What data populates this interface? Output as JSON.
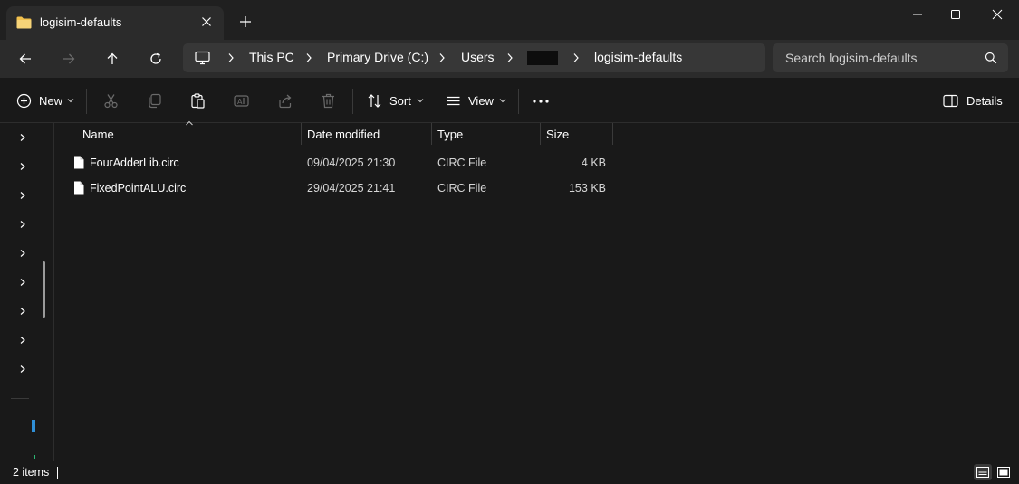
{
  "tab": {
    "title": "logisim-defaults"
  },
  "breadcrumb": {
    "items": [
      "This PC",
      "Primary Drive (C:)",
      "Users",
      "logisim-defaults"
    ]
  },
  "search": {
    "placeholder": "Search logisim-defaults"
  },
  "toolbar": {
    "new_label": "New",
    "sort_label": "Sort",
    "view_label": "View",
    "details_label": "Details"
  },
  "columns": {
    "name": "Name",
    "date": "Date modified",
    "type": "Type",
    "size": "Size"
  },
  "files": [
    {
      "name": "FourAdderLib.circ",
      "date": "09/04/2025 21:30",
      "type": "CIRC File",
      "size": "4 KB"
    },
    {
      "name": "FixedPointALU.circ",
      "date": "29/04/2025 21:41",
      "type": "CIRC File",
      "size": "153 KB"
    }
  ],
  "status": {
    "item_count": "2 items"
  },
  "colors": {
    "background": "#191919",
    "accent_folder": "#f2c14e",
    "address_bg": "#373737"
  },
  "icons": [
    "folder-icon",
    "close-icon",
    "plus-icon",
    "minimize-icon",
    "maximize-icon",
    "back-icon",
    "forward-icon",
    "up-icon",
    "refresh-icon",
    "computer-icon",
    "search-icon",
    "cut-icon",
    "copy-icon",
    "paste-icon",
    "rename-icon",
    "share-icon",
    "delete-icon",
    "sort-icon",
    "view-icon",
    "more-icon",
    "details-pane-icon",
    "file-icon",
    "chevron-right-icon"
  ]
}
